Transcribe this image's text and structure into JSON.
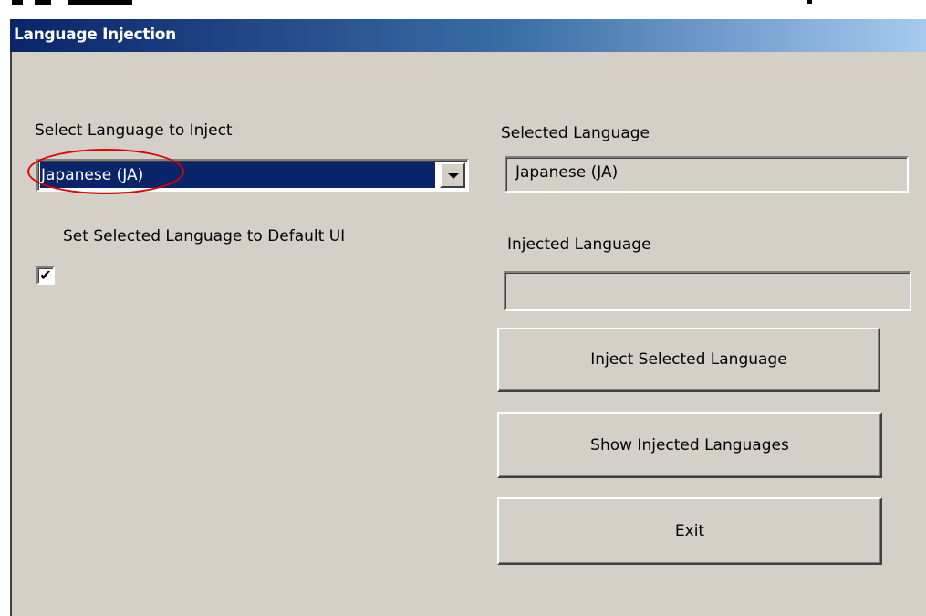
{
  "window": {
    "title": "Language Injection"
  },
  "left": {
    "select_label": "Select Language to Inject",
    "dropdown_value": "Japanese (JA)",
    "checkbox_label": "Set Selected Language to Default UI",
    "checkbox_checked": true,
    "checkbox_mark": "✔"
  },
  "right": {
    "selected_label": "Selected Language",
    "selected_value": "Japanese (JA)",
    "injected_label": "Injected Language",
    "injected_value": ""
  },
  "buttons": {
    "inject": "Inject Selected Language",
    "show": "Show Injected Languages",
    "exit": "Exit"
  },
  "colors": {
    "titlebar_start": "#0a246a",
    "titlebar_end": "#a6caf0",
    "face": "#d4d0c8",
    "selection": "#0a246a",
    "annotation": "#e00000"
  }
}
